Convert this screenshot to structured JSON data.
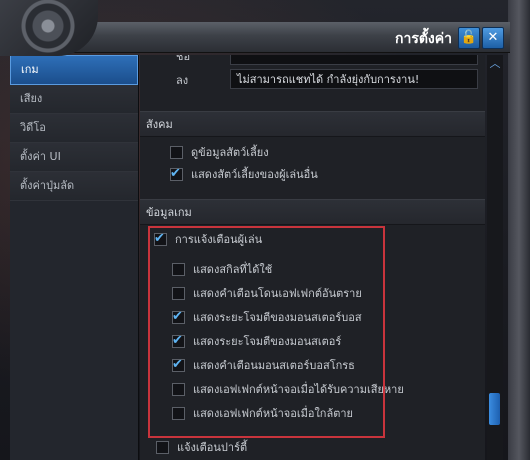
{
  "window": {
    "title": "การตั้งค่า",
    "lock_icon": "lock-icon",
    "close_icon": "close-icon"
  },
  "sidebar": {
    "items": [
      {
        "label": "เกม",
        "active": true
      },
      {
        "label": "เสียง",
        "active": false
      },
      {
        "label": "วิดีโอ",
        "active": false
      },
      {
        "label": "ตั้งค่า UI",
        "active": false
      },
      {
        "label": "ตั้งค่าปุ่มลัด",
        "active": false
      }
    ]
  },
  "fields": {
    "top_partial_label": "ชื่อ",
    "top_partial_value": "",
    "leave_label": "ลง",
    "leave_value": "ไม่สามารถแชทได้ กำลังยุ่งกับการงาน!"
  },
  "sections": {
    "social": {
      "title": "สังคม",
      "options": [
        {
          "label": "ดูข้อมูลสัตว์เลี้ยง",
          "checked": false
        },
        {
          "label": "แสดงสัตว์เลี้ยงของผู้เล่นอื่น",
          "checked": true
        }
      ]
    },
    "game_info": {
      "title": "ข้อมูลเกม",
      "master": {
        "label": "การแจ้งเตือนผู้เล่น",
        "checked": true
      },
      "options": [
        {
          "label": "แสดงสกิลที่ได้ใช้",
          "checked": false
        },
        {
          "label": "แสดงคำเตือนโดนเอฟเฟกต์อันตราย",
          "checked": false
        },
        {
          "label": "แสดงระยะโจมตีของมอนสเตอร์บอส",
          "checked": true
        },
        {
          "label": "แสดงระยะโจมตีของมอนสเตอร์",
          "checked": true
        },
        {
          "label": "แสดงคำเตือนมอนสเตอร์บอสโกรธ",
          "checked": true
        },
        {
          "label": "แสดงเอฟเฟกต์หน้าจอเมื่อได้รับความเสียหาย",
          "checked": false
        },
        {
          "label": "แสดงเอฟเฟกต์หน้าจอเมื่อใกล้ตาย",
          "checked": false
        }
      ],
      "next_item": {
        "label": "แจ้งเตือนปาร์ตี้",
        "checked": false
      }
    }
  },
  "colors": {
    "accent": "#2e6fb8",
    "highlight_border": "#c8343c",
    "check": "#5fb4f2"
  }
}
